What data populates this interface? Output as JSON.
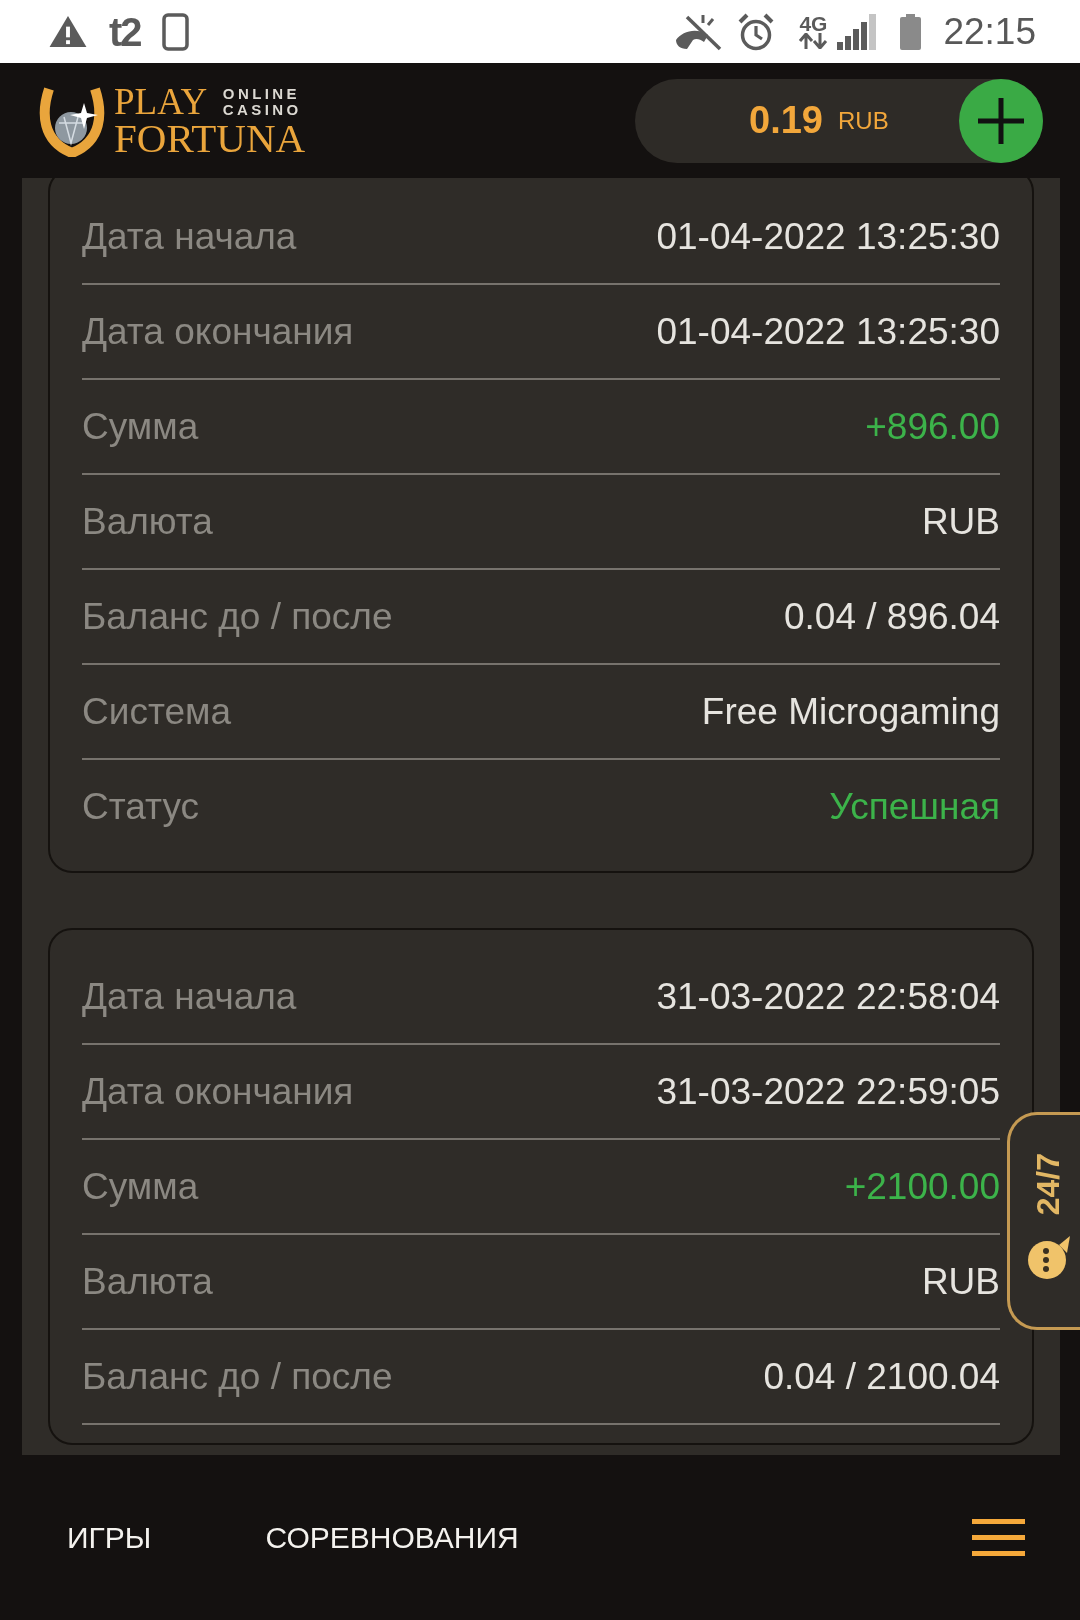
{
  "status_bar": {
    "carrier": "t2",
    "network_type": "4G",
    "time": "22:15"
  },
  "header": {
    "logo": {
      "title_top": "PLAY",
      "tagline_top": "ONLINE",
      "tagline_bottom": "CASINO",
      "title_bottom": "FORTUNA"
    },
    "balance": {
      "amount": "0.19",
      "currency": "RUB"
    }
  },
  "transactions": [
    {
      "rows": [
        {
          "label": "Дата начала",
          "value": "01-04-2022 13:25:30",
          "kind": "plain"
        },
        {
          "label": "Дата окончания",
          "value": "01-04-2022 13:25:30",
          "kind": "plain"
        },
        {
          "label": "Сумма",
          "value": "+896.00",
          "kind": "positive"
        },
        {
          "label": "Валюта",
          "value": "RUB",
          "kind": "plain"
        },
        {
          "label": "Баланс до / после",
          "value": "0.04 / 896.04",
          "kind": "plain"
        },
        {
          "label": "Система",
          "value": "Free Microgaming",
          "kind": "plain"
        },
        {
          "label": "Статус",
          "value": "Успешная",
          "kind": "positive"
        }
      ]
    },
    {
      "rows": [
        {
          "label": "Дата начала",
          "value": "31-03-2022 22:58:04",
          "kind": "plain"
        },
        {
          "label": "Дата окончания",
          "value": "31-03-2022 22:59:05",
          "kind": "plain"
        },
        {
          "label": "Сумма",
          "value": "+2100.00",
          "kind": "positive"
        },
        {
          "label": "Валюта",
          "value": "RUB",
          "kind": "plain"
        },
        {
          "label": "Баланс до / после",
          "value": "0.04 / 2100.04",
          "kind": "plain"
        }
      ]
    }
  ],
  "support_tab": {
    "label": "24/7"
  },
  "bottom_nav": {
    "items": [
      {
        "label": "ИГРЫ"
      },
      {
        "label": "СОРЕВНОВАНИЯ"
      }
    ]
  }
}
